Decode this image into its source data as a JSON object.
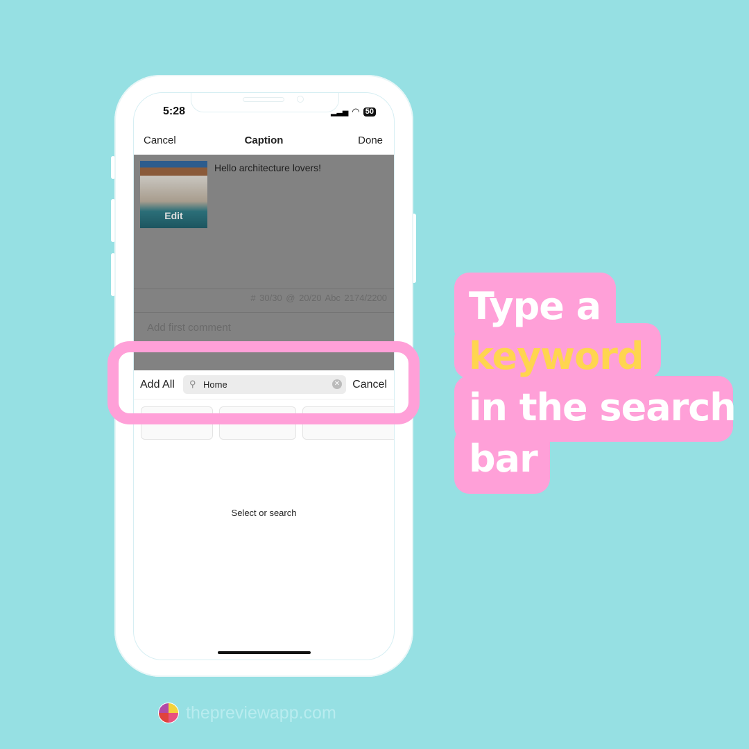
{
  "status_bar": {
    "time": "5:28",
    "battery": "50"
  },
  "nav": {
    "cancel": "Cancel",
    "title": "Caption",
    "done": "Done"
  },
  "post": {
    "edit_label": "Edit",
    "caption": "Hello architecture lovers!",
    "counts": "# 30/30   @ 20/20   Abc 2174/2200",
    "comment_placeholder": "Add first comment"
  },
  "search": {
    "add_all": "Add All",
    "value": "Home",
    "cancel": "Cancel"
  },
  "empty_state": "Select or search",
  "callout": {
    "line1": "Type a",
    "line2": "keyword",
    "line3": "in the search",
    "line4": "bar",
    "highlight_color": "#ffd54f",
    "box_color": "#ffa0d8"
  },
  "footer": {
    "site": "thepreviewapp.com"
  }
}
